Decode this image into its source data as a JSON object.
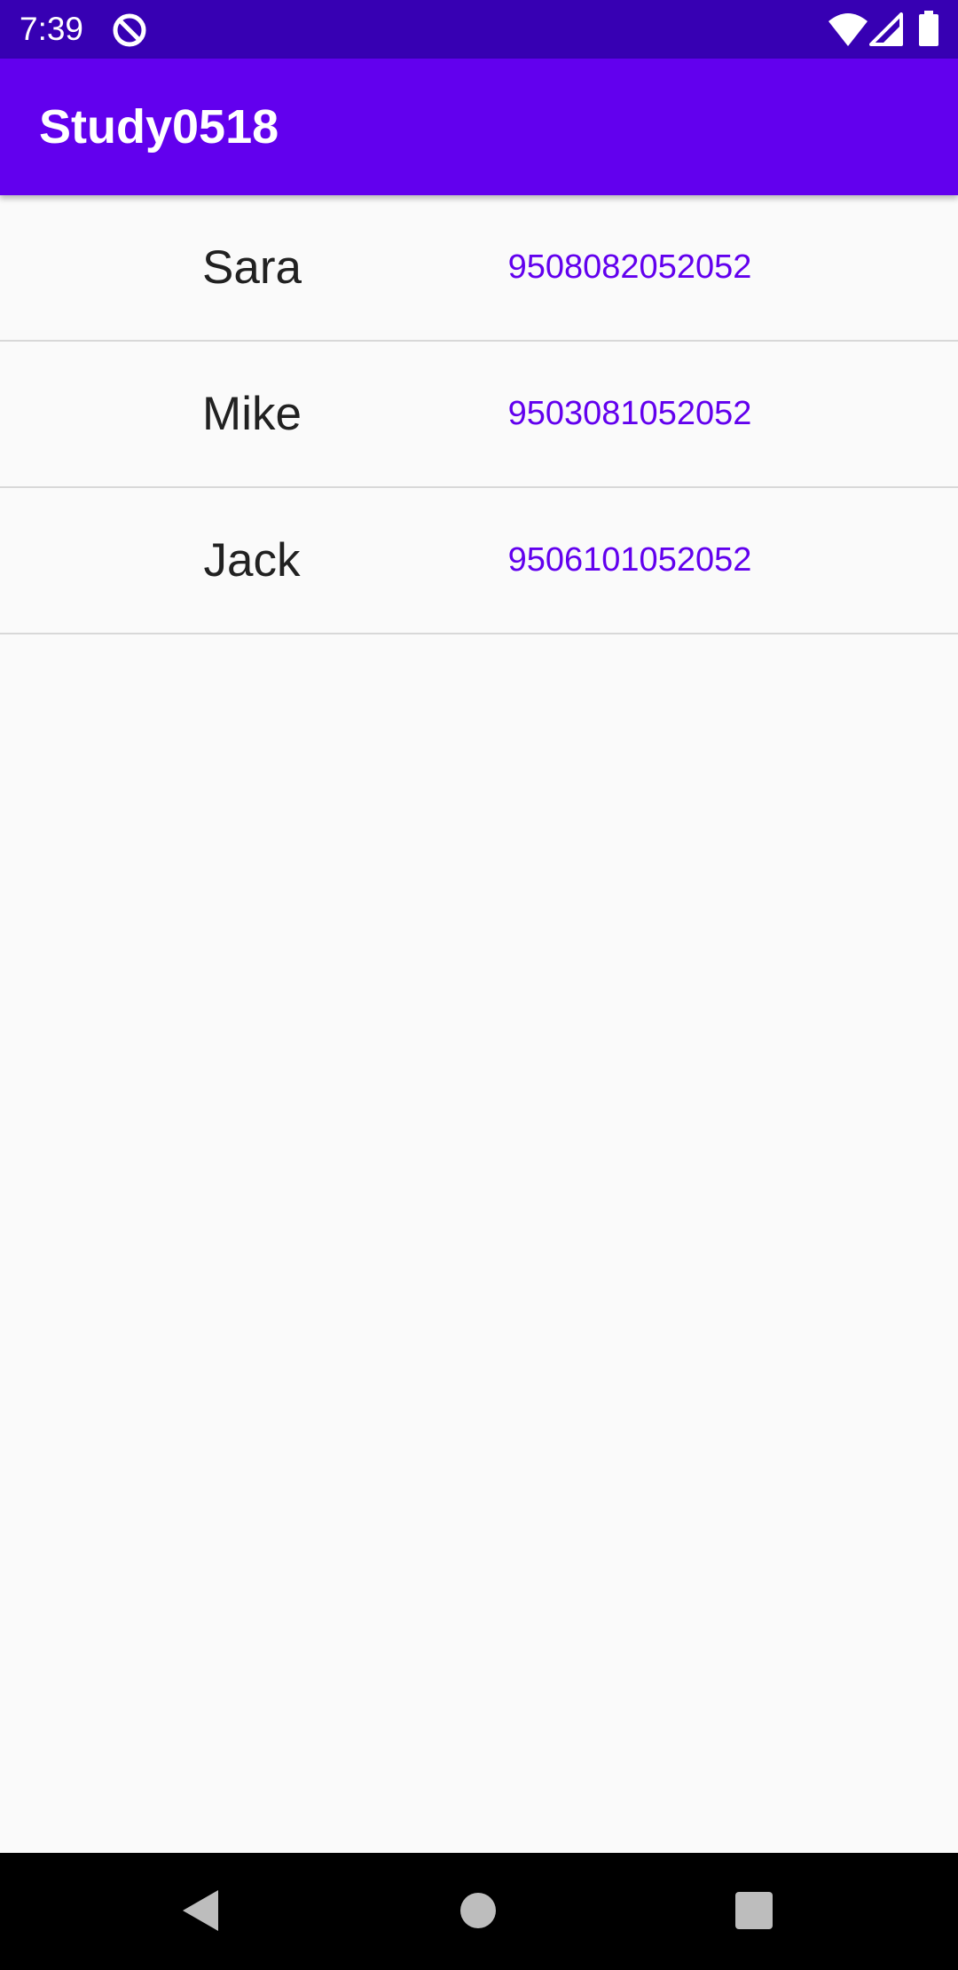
{
  "status_bar": {
    "time": "7:39",
    "icons": [
      "app-notification-icon",
      "wifi-icon",
      "signal-icon",
      "battery-icon"
    ]
  },
  "app_bar": {
    "title": "Study0518"
  },
  "contacts": [
    {
      "name": "Sara",
      "phone": "9508082052052"
    },
    {
      "name": "Mike",
      "phone": "9503081052052"
    },
    {
      "name": "Jack",
      "phone": "9506101052052"
    }
  ],
  "nav_bar": {
    "icons": [
      "back-icon",
      "home-icon",
      "recents-icon"
    ]
  },
  "colors": {
    "status_bar": "#3700B3",
    "primary": "#6200EE",
    "background": "#FAFAFA",
    "name_text": "#212121",
    "divider": "#D8D8D8"
  }
}
